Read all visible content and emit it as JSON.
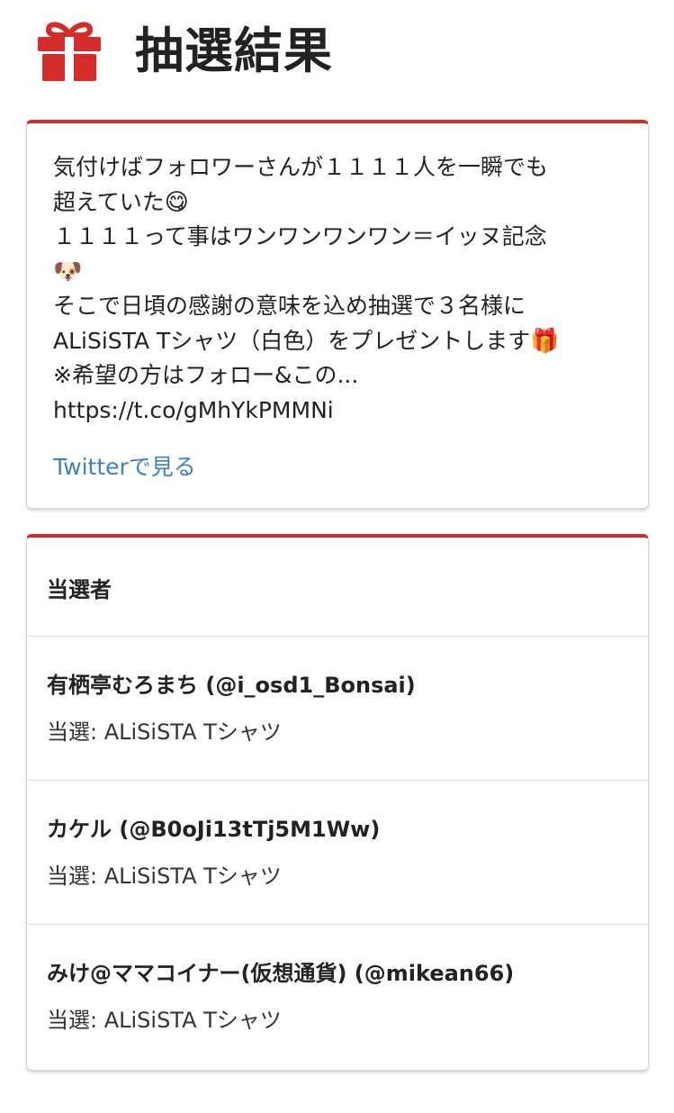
{
  "header": {
    "icon": "gift-icon",
    "title": "抽選結果",
    "accent_color": "#d42b2b"
  },
  "tweet": {
    "lines": [
      "気付けばフォロワーさんが１１１１人を一瞬でも",
      "超えていた",
      "１１１１って事はワンワンワンワン＝イッヌ記念",
      "",
      "そこで日頃の感謝の意味を込め抽選で３名様に",
      "ALiSiSTA Tシャツ（白色）をプレゼントします",
      "※希望の方はフォロー&この...",
      "https://t.co/gMhYkPMMNi"
    ],
    "emojis": {
      "line2": "😋",
      "line4": "🐶",
      "line6": "🎁"
    },
    "link_label": "Twitterで見る",
    "link_color": "#3b82c4"
  },
  "winners": {
    "title": "当選者",
    "items": [
      {
        "name": "有栖亭むろまち (@i_osd1_Bonsai)",
        "prize": "当選: ALiSiSTA Tシャツ"
      },
      {
        "name": "カケル (@B0oJi13tTj5M1Ww)",
        "prize": "当選: ALiSiSTA Tシャツ"
      },
      {
        "name": "みけ@ママコイナー(仮想通貨) (@mikean66)",
        "prize": "当選: ALiSiSTA Tシャツ"
      }
    ]
  }
}
